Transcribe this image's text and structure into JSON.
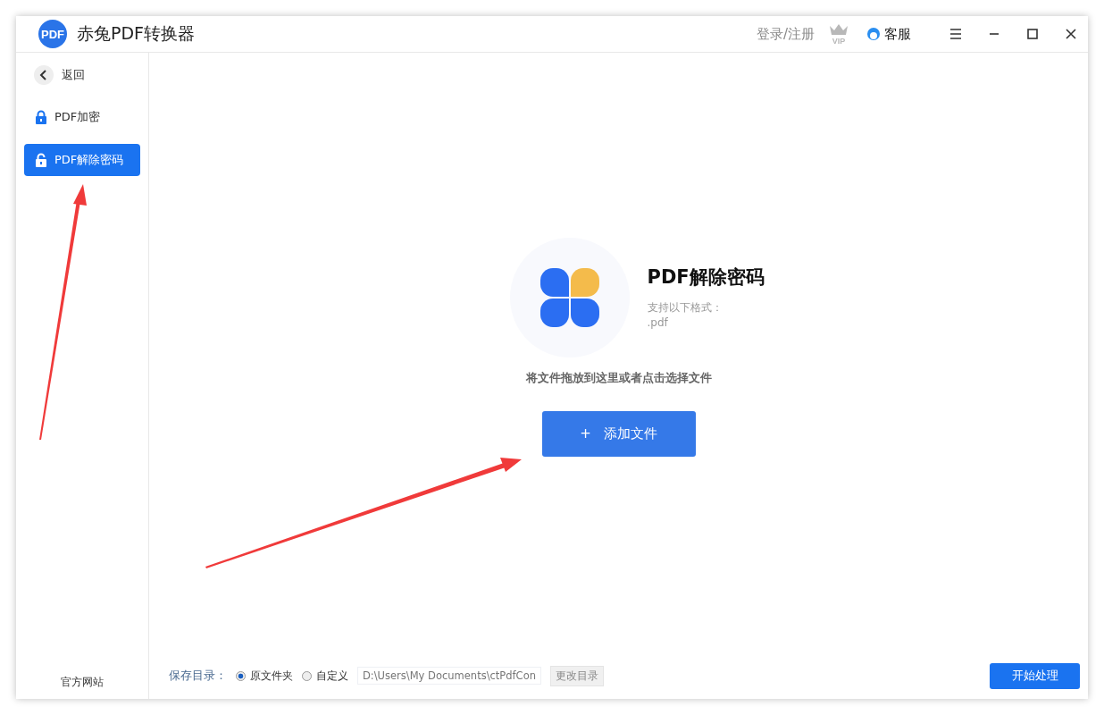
{
  "app": {
    "logo_text": "PDF",
    "title": "赤兔PDF转换器"
  },
  "header": {
    "login": "登录/注册",
    "vip": "VIP",
    "support": "客服"
  },
  "sidebar": {
    "back": "返回",
    "items": [
      {
        "label": "PDF加密",
        "selected": false,
        "locked": true
      },
      {
        "label": "PDF解除密码",
        "selected": true,
        "locked": false
      }
    ],
    "footer_link": "官方网站"
  },
  "main": {
    "title": "PDF解除密码",
    "formats_label": "支持以下格式：",
    "formats": ".pdf",
    "drop_hint": "将文件拖放到这里或者点击选择文件",
    "add_button": {
      "icon": "+",
      "label": "添加文件"
    }
  },
  "footer": {
    "save_label": "保存目录：",
    "options": [
      {
        "label": "原文件夹",
        "selected": true
      },
      {
        "label": "自定义",
        "selected": false
      }
    ],
    "path": "D:\\Users\\My Documents\\ctPdfCon",
    "change_button": "更改目录",
    "start_button": "开始处理"
  }
}
